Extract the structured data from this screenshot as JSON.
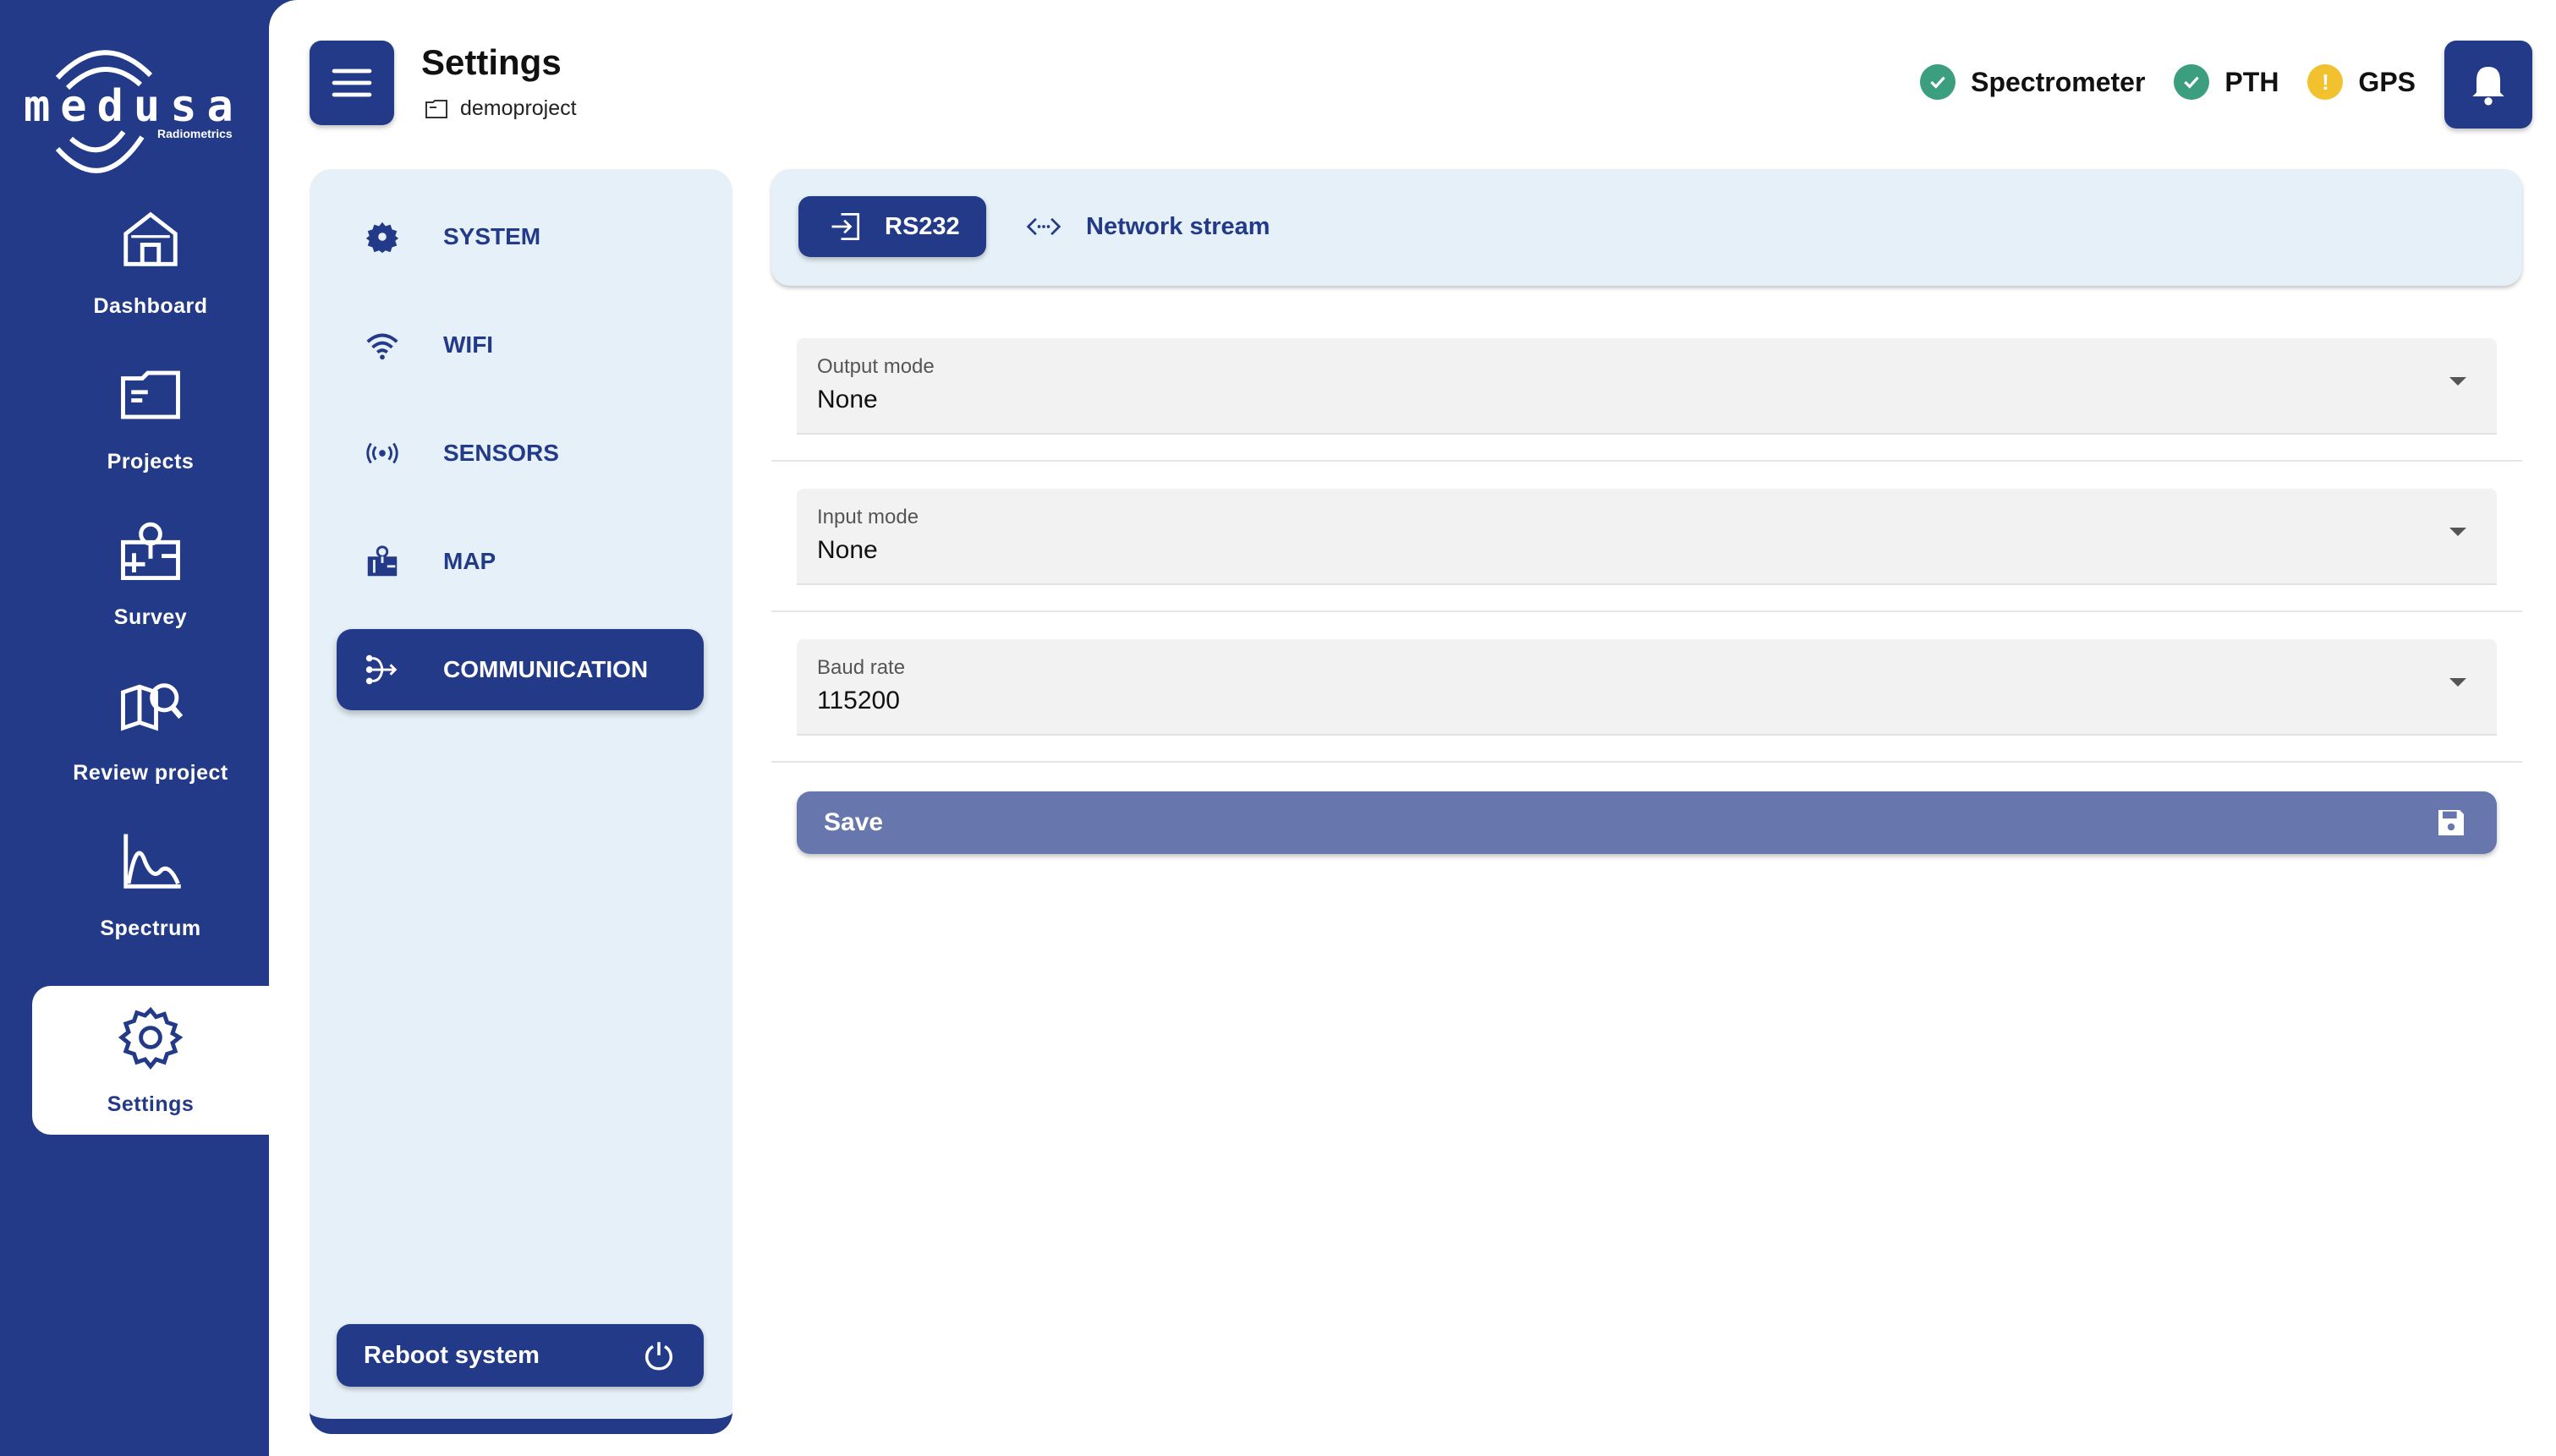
{
  "brand": {
    "name": "medusa",
    "tagline": "Radiometrics"
  },
  "sidebar": {
    "items": [
      {
        "label": "Dashboard",
        "icon": "home-icon"
      },
      {
        "label": "Projects",
        "icon": "folder-icon"
      },
      {
        "label": "Survey",
        "icon": "map-pin-icon"
      },
      {
        "label": "Review project",
        "icon": "map-search-icon"
      },
      {
        "label": "Spectrum",
        "icon": "spectrum-chart-icon"
      },
      {
        "label": "Settings",
        "icon": "gear-icon",
        "active": true
      }
    ]
  },
  "header": {
    "title": "Settings",
    "project": "demoproject",
    "status": [
      {
        "label": "Spectrometer",
        "state": "ok",
        "color": "#3a9e7f"
      },
      {
        "label": "PTH",
        "state": "ok",
        "color": "#3a9e7f"
      },
      {
        "label": "GPS",
        "state": "warning",
        "color": "#f2c12e",
        "symbol": "!"
      }
    ]
  },
  "settings_menu": {
    "items": [
      {
        "label": "SYSTEM",
        "icon": "gear-icon"
      },
      {
        "label": "WIFI",
        "icon": "wifi-icon"
      },
      {
        "label": "SENSORS",
        "icon": "sensor-broadcast-icon"
      },
      {
        "label": "MAP",
        "icon": "map-icon"
      },
      {
        "label": "COMMUNICATION",
        "icon": "communication-icon",
        "active": true
      }
    ],
    "reboot_label": "Reboot system"
  },
  "tabs": [
    {
      "label": "RS232",
      "icon": "input-arrow-icon",
      "active": true
    },
    {
      "label": "Network stream",
      "icon": "code-brackets-icon"
    }
  ],
  "form": {
    "output_mode": {
      "label": "Output mode",
      "value": "None"
    },
    "input_mode": {
      "label": "Input mode",
      "value": "None"
    },
    "baud_rate": {
      "label": "Baud rate",
      "value": "115200"
    },
    "save_label": "Save"
  },
  "colors": {
    "primary": "#233a89",
    "panel": "#e6f0f8",
    "save": "#6777ad",
    "ok": "#3a9e7f",
    "warning": "#f2c12e"
  }
}
